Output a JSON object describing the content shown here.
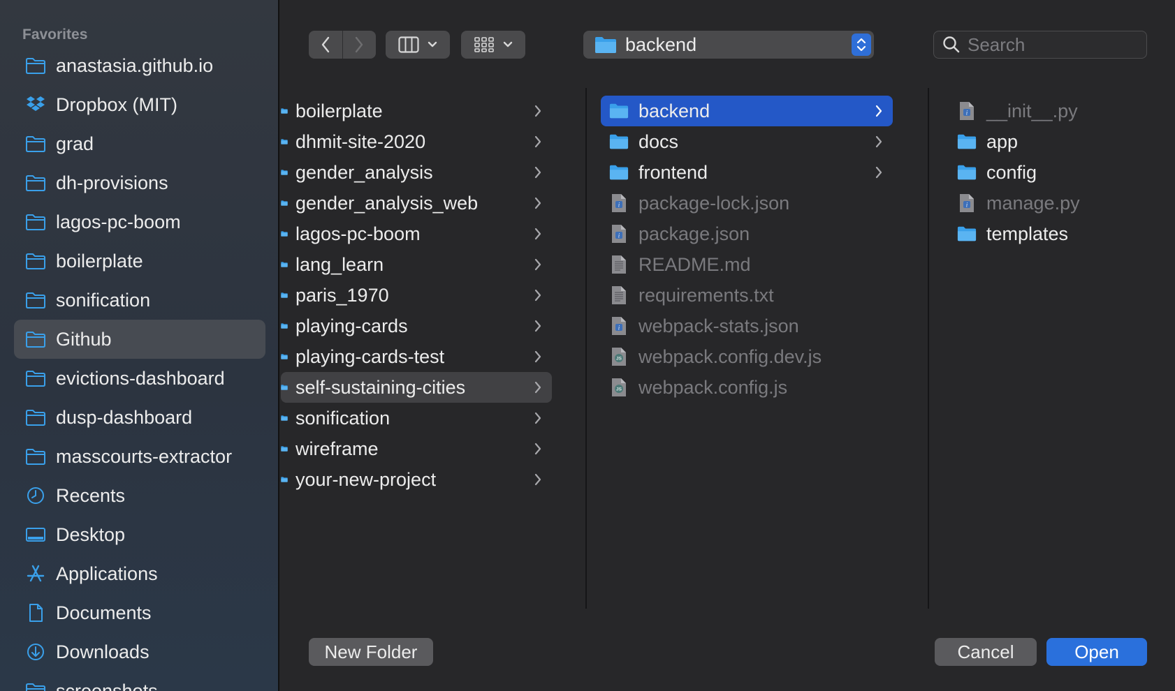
{
  "sidebar": {
    "header": "Favorites",
    "items": [
      {
        "label": "anastasia.github.io",
        "icon": "folder-icon"
      },
      {
        "label": "Dropbox (MIT)",
        "icon": "dropbox-icon"
      },
      {
        "label": "grad",
        "icon": "folder-icon"
      },
      {
        "label": "dh-provisions",
        "icon": "folder-icon"
      },
      {
        "label": "lagos-pc-boom",
        "icon": "folder-icon"
      },
      {
        "label": "boilerplate",
        "icon": "folder-icon"
      },
      {
        "label": "sonification",
        "icon": "folder-icon"
      },
      {
        "label": "Github",
        "icon": "folder-icon",
        "selected": true
      },
      {
        "label": "evictions-dashboard",
        "icon": "folder-icon"
      },
      {
        "label": "dusp-dashboard",
        "icon": "folder-icon"
      },
      {
        "label": "masscourts-extractor",
        "icon": "folder-icon"
      },
      {
        "label": "Recents",
        "icon": "clock-icon"
      },
      {
        "label": "Desktop",
        "icon": "desktop-icon"
      },
      {
        "label": "Applications",
        "icon": "applications-icon"
      },
      {
        "label": "Documents",
        "icon": "document-icon"
      },
      {
        "label": "Downloads",
        "icon": "download-icon"
      },
      {
        "label": "screenshots",
        "icon": "folder-icon"
      }
    ]
  },
  "toolbar": {
    "path_label": "backend",
    "search_placeholder": "Search"
  },
  "columns": {
    "first": [
      {
        "label": "boilerplate"
      },
      {
        "label": "dhmit-site-2020"
      },
      {
        "label": "gender_analysis"
      },
      {
        "label": "gender_analysis_web"
      },
      {
        "label": "lagos-pc-boom"
      },
      {
        "label": "lang_learn"
      },
      {
        "label": "paris_1970"
      },
      {
        "label": "playing-cards"
      },
      {
        "label": "playing-cards-test"
      },
      {
        "label": "self-sustaining-cities",
        "state": "parent-selected"
      },
      {
        "label": "sonification"
      },
      {
        "label": "wireframe"
      },
      {
        "label": "your-new-project"
      }
    ],
    "second": [
      {
        "label": "backend",
        "type": "folder",
        "state": "selected"
      },
      {
        "label": "docs",
        "type": "folder"
      },
      {
        "label": "frontend",
        "type": "folder"
      },
      {
        "label": "package-lock.json",
        "type": "json"
      },
      {
        "label": "package.json",
        "type": "json"
      },
      {
        "label": "README.md",
        "type": "text"
      },
      {
        "label": "requirements.txt",
        "type": "text"
      },
      {
        "label": "webpack-stats.json",
        "type": "json"
      },
      {
        "label": "webpack.config.dev.js",
        "type": "js"
      },
      {
        "label": "webpack.config.js",
        "type": "js"
      }
    ],
    "third": [
      {
        "label": "__init__.py",
        "type": "py"
      },
      {
        "label": "app",
        "type": "folder"
      },
      {
        "label": "config",
        "type": "folder"
      },
      {
        "label": "manage.py",
        "type": "py"
      },
      {
        "label": "templates",
        "type": "folder"
      }
    ]
  },
  "footer": {
    "new_folder_label": "New Folder",
    "cancel_label": "Cancel",
    "open_label": "Open"
  },
  "colors": {
    "accent": "#2a70dc",
    "selection": "#2458c7",
    "folder": "#3aa0ea"
  }
}
